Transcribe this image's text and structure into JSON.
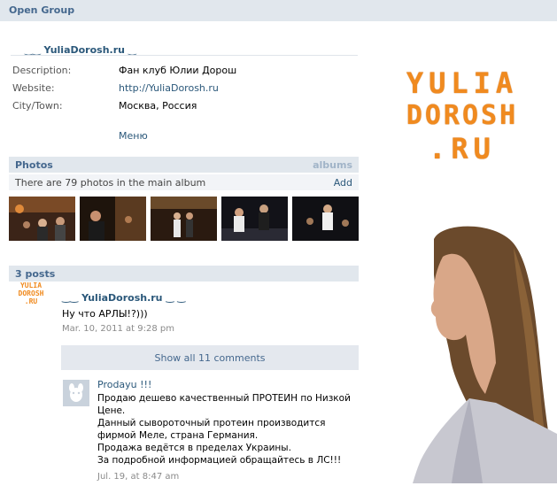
{
  "header": {
    "title": "Open Group"
  },
  "group": {
    "name": "YuliaDorosh.ru",
    "info": [
      {
        "label": "Description:",
        "value": "Фан клуб Юлии Дорош",
        "link": false
      },
      {
        "label": "Website:",
        "value": "http://YuliaDorosh.ru",
        "link": true
      },
      {
        "label": "City/Town:",
        "value": "Москва, Россия",
        "link": false
      }
    ],
    "menu_label": "Меню"
  },
  "photos": {
    "title": "Photos",
    "albums_label": "albums",
    "summary": "There are 79 photos in the main album",
    "add_label": "Add",
    "count": 5
  },
  "posts": {
    "title": "3 posts",
    "items": [
      {
        "author": "YuliaDorosh.ru",
        "text": "Ну что АРЛЫ!?)))",
        "date": "Mar. 10, 2011 at 9:28 pm",
        "show_all": "Show all 11 comments",
        "comment": {
          "author": "Prodayu !!!",
          "lines": [
            "Продаю дешево качественный ПРОТЕИН по Низкой",
            "Цене.",
            "Данный сывороточный протеин производится",
            "фирмой Меле, страна Германия.",
            "Продажа ведётся в пределах Украины.",
            "За подробной информацией обращайтесь в ЛС!!!"
          ],
          "date": "Jul. 19, at 8:47 am"
        }
      }
    ]
  },
  "brand": {
    "lines": [
      "YULIA",
      "DOROSH",
      ".RU"
    ],
    "mini": [
      "YULIA",
      "DOROSH",
      ".RU"
    ]
  },
  "colors": {
    "accent": "#45688e",
    "link": "#2b587a",
    "brand_orange": "#f08a1f",
    "header_bg": "#e1e7ed"
  }
}
